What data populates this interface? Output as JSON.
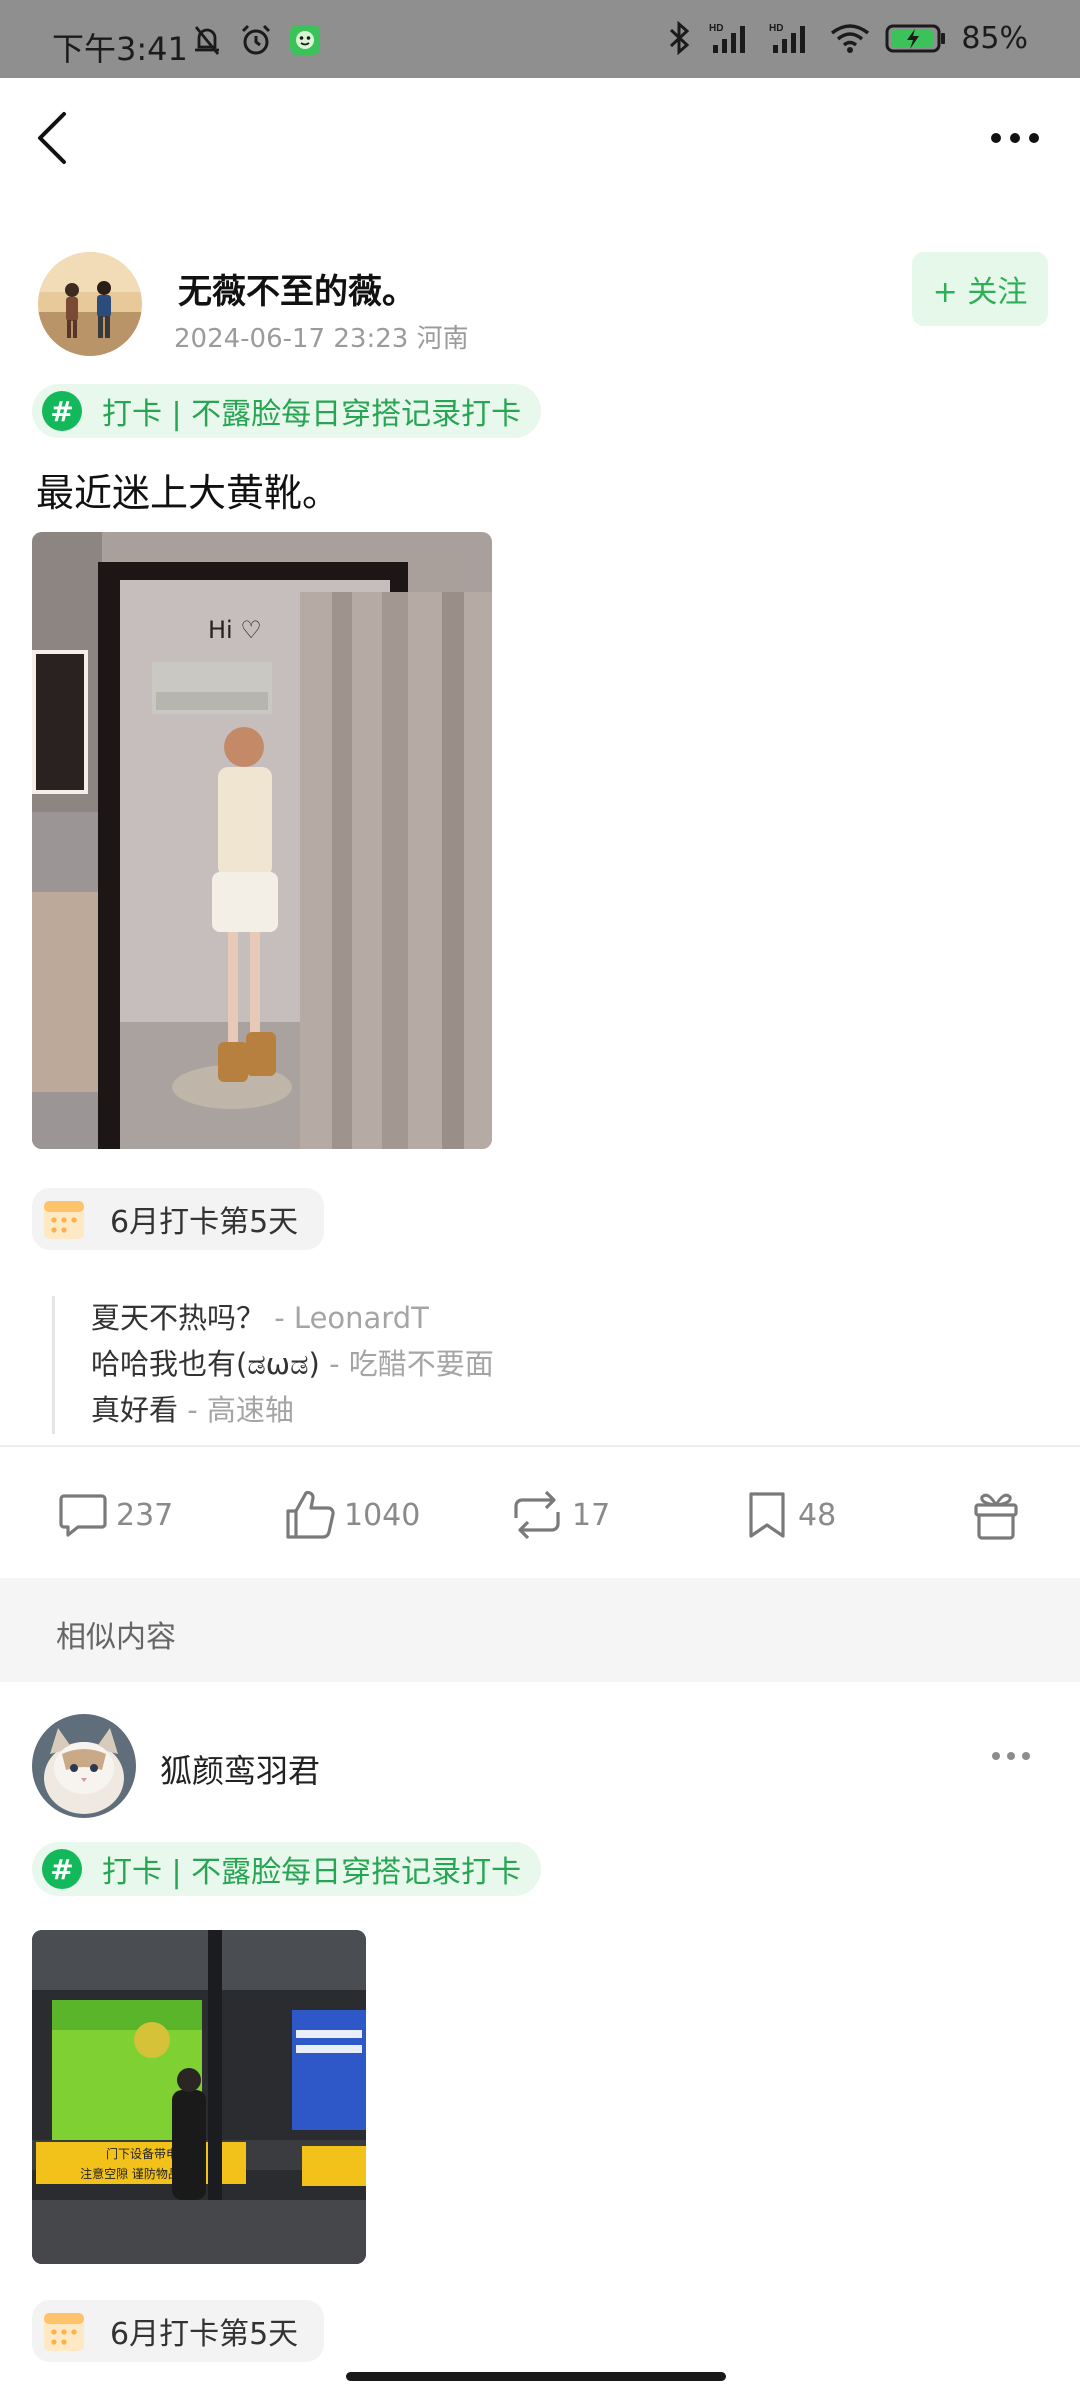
{
  "status_bar": {
    "time": "下午3:41",
    "battery": "85%",
    "icons": [
      "mute-icon",
      "alarm-icon",
      "app-notification-icon",
      "bluetooth-icon",
      "signal-hd-icon",
      "signal-hd-icon",
      "wifi-icon",
      "battery-charging-icon"
    ]
  },
  "header": {
    "back_icon": "chevron-left-icon",
    "more_icon": "more-horizontal-icon"
  },
  "post": {
    "author": {
      "name": "无薇不至的薇。",
      "date": "2024-06-17 23:23",
      "location": "河南",
      "follow_label": "+ 关注"
    },
    "topic": "打卡 | 不露脸每日穿搭记录打卡",
    "text": "最近迷上大黄靴。",
    "image": {
      "caption": "Hi ♡"
    },
    "checkin": "6月打卡第5天",
    "comments": [
      {
        "text": "夏天不热吗？",
        "author": " - LeonardT"
      },
      {
        "text": "哈哈我也有(ಡωಡ)",
        "author": " - 吃醋不要面"
      },
      {
        "text": "真好看",
        "author": " - 高速轴"
      }
    ],
    "actions": {
      "comments": "237",
      "likes": "1040",
      "reposts": "17",
      "bookmarks": "48"
    }
  },
  "similar": {
    "title": "相似内容",
    "card": {
      "author": "狐颜鸾羽君",
      "topic": "打卡 | 不露脸每日穿搭记录打卡",
      "checkin": "6月打卡第5天",
      "image_text": {
        "warning_top": "门下设备带电",
        "warning_bottom": "注意空隙 谨防物品掉落"
      }
    }
  },
  "colors": {
    "accent_green": "#2fae58",
    "topic_bg": "#e8f8ed",
    "status_bar_bg": "#8f8f8f"
  }
}
